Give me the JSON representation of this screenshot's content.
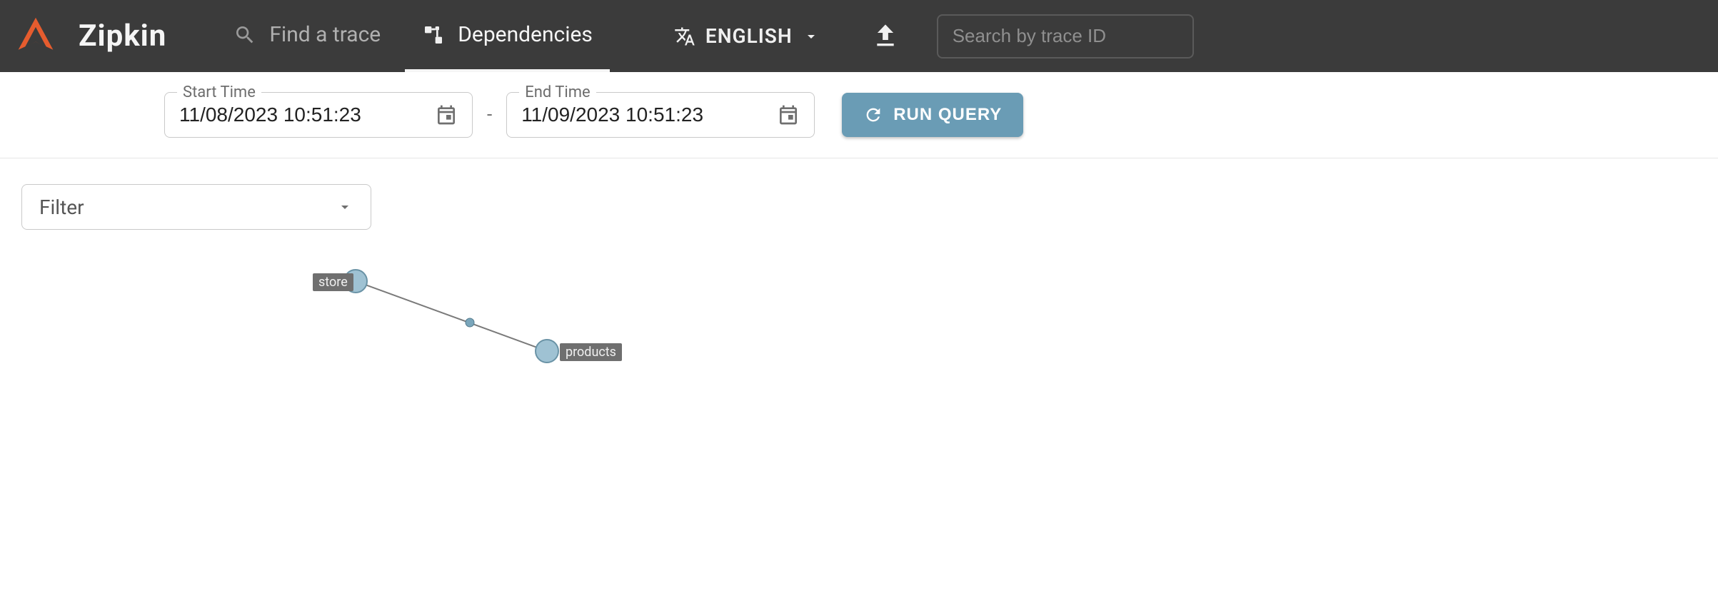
{
  "header": {
    "app_name": "Zipkin",
    "nav": {
      "find_trace": "Find a trace",
      "dependencies": "Dependencies"
    },
    "language": "ENGLISH",
    "search_placeholder": "Search by trace ID"
  },
  "query": {
    "start_label": "Start Time",
    "start_value": "11/08/2023 10:51:23",
    "end_label": "End Time",
    "end_value": "11/09/2023 10:51:23",
    "run_label": "RUN QUERY"
  },
  "filter": {
    "placeholder": "Filter"
  },
  "graph": {
    "nodes": {
      "store": "store",
      "products": "products"
    }
  }
}
